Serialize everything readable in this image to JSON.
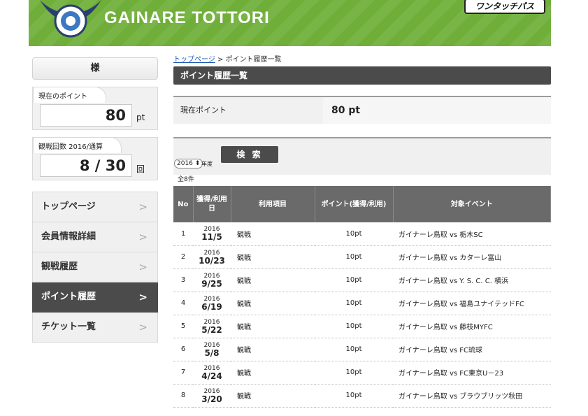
{
  "header": {
    "club_name": "GAINARE TOTTORI",
    "partner_logo_text": "ワンタッチパス"
  },
  "sidebar": {
    "user_name": "様",
    "points": {
      "label": "現在のポイント",
      "value": "80",
      "unit": "pt"
    },
    "attendance": {
      "label": "観戦回数 2016/通算",
      "value": "8 / 30",
      "unit": "回"
    },
    "nav": [
      {
        "label": "トップページ"
      },
      {
        "label": "会員情報詳細"
      },
      {
        "label": "観戦履歴"
      },
      {
        "label": "ポイント履歴",
        "active": true
      },
      {
        "label": "チケット一覧"
      }
    ],
    "chevron": ">"
  },
  "breadcrumb": {
    "home": "トップページ",
    "separator": " > ",
    "current": "ポイント履歴一覧"
  },
  "page_title": "ポイント履歴一覧",
  "current_points": {
    "label": "現在ポイント",
    "value": "80 pt"
  },
  "search": {
    "year_value": "2016",
    "year_label": "年度",
    "button_label": "検 索",
    "total_label": "全8件"
  },
  "table": {
    "headers": {
      "no": "No",
      "date": "獲得/利用日",
      "item": "利用項目",
      "points": "ポイント(獲得/利用)",
      "event": "対象イベント"
    },
    "rows": [
      {
        "no": "1",
        "year": "2016",
        "date": "11/5",
        "item": "観戦",
        "points": "10pt",
        "event": "ガイナーレ鳥取 vs 栃木SC"
      },
      {
        "no": "2",
        "year": "2016",
        "date": "10/23",
        "item": "観戦",
        "points": "10pt",
        "event": "ガイナーレ鳥取 vs カターレ富山"
      },
      {
        "no": "3",
        "year": "2016",
        "date": "9/25",
        "item": "観戦",
        "points": "10pt",
        "event": "ガイナーレ鳥取 vs Y. S. C. C. 横浜"
      },
      {
        "no": "4",
        "year": "2016",
        "date": "6/19",
        "item": "観戦",
        "points": "10pt",
        "event": "ガイナーレ鳥取 vs 福島ユナイテッドFC"
      },
      {
        "no": "5",
        "year": "2016",
        "date": "5/22",
        "item": "観戦",
        "points": "10pt",
        "event": "ガイナーレ鳥取 vs 藤枝MYFC"
      },
      {
        "no": "6",
        "year": "2016",
        "date": "5/8",
        "item": "観戦",
        "points": "10pt",
        "event": "ガイナーレ鳥取 vs FC琉球"
      },
      {
        "no": "7",
        "year": "2016",
        "date": "4/24",
        "item": "観戦",
        "points": "10pt",
        "event": "ガイナーレ鳥取 vs FC東京U－23"
      },
      {
        "no": "8",
        "year": "2016",
        "date": "3/20",
        "item": "観戦",
        "points": "10pt",
        "event": "ガイナーレ鳥取 vs ブラウブリッツ秋田"
      }
    ]
  }
}
